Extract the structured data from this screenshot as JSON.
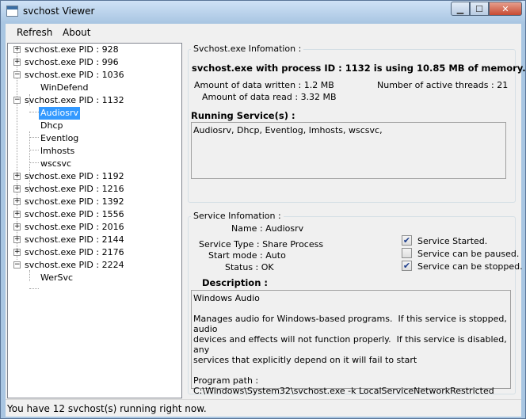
{
  "window": {
    "title": "svchost Viewer",
    "min": "▁",
    "max": "☐",
    "close": "✕"
  },
  "menu": {
    "refresh": "Refresh",
    "about": "About"
  },
  "tree": {
    "nodes": [
      {
        "label": "svchost.exe  PID : 928",
        "expander": "+"
      },
      {
        "label": "svchost.exe  PID : 996",
        "expander": "+"
      },
      {
        "label": "svchost.exe  PID : 1036",
        "expander": "−"
      },
      {
        "label": "WinDefend"
      },
      {
        "label": "svchost.exe  PID : 1132",
        "expander": "−"
      },
      {
        "label": "Audiosrv"
      },
      {
        "label": "Dhcp"
      },
      {
        "label": "Eventlog"
      },
      {
        "label": "lmhosts"
      },
      {
        "label": "wscsvc"
      },
      {
        "label": "svchost.exe  PID : 1192",
        "expander": "+"
      },
      {
        "label": "svchost.exe  PID : 1216",
        "expander": "+"
      },
      {
        "label": "svchost.exe  PID : 1392",
        "expander": "+"
      },
      {
        "label": "svchost.exe  PID : 1556",
        "expander": "+"
      },
      {
        "label": "svchost.exe  PID : 2016",
        "expander": "+"
      },
      {
        "label": "svchost.exe  PID : 2144",
        "expander": "+"
      },
      {
        "label": "svchost.exe  PID : 2176",
        "expander": "+"
      },
      {
        "label": "svchost.exe  PID : 2224",
        "expander": "−"
      },
      {
        "label": "WerSvc"
      }
    ]
  },
  "info": {
    "group_title": "Svchost.exe Infomation :",
    "headline": "svchost.exe with process ID : 1132 is using 10.85 MB of memory.",
    "data_written": "Amount of data written : 1.2 MB",
    "data_read": "Amount of data read : 3.32 MB",
    "threads": "Number of active threads : 21",
    "running_label": "Running Service(s) :",
    "running_value": "Audiosrv, Dhcp, Eventlog, lmhosts, wscsvc,"
  },
  "service": {
    "group_title": "Service Infomation :",
    "name": "Name : Audiosrv",
    "type": "Service Type : Share Process",
    "start_mode": "Start mode : Auto",
    "status": "Status : OK",
    "started_label": "Service Started.",
    "paused_label": "Service can be paused.",
    "stopped_label": "Service can be stopped.",
    "started_checked": "✔",
    "paused_checked": "",
    "stopped_checked": "✔",
    "description_label": "Description :",
    "description_text": "Windows Audio\n\nManages audio for Windows-based programs.  If this service is stopped, audio\ndevices and effects will not function properly.  If this service is disabled, any\nservices that explicitly depend on it will fail to start\n\nProgram path :\nC:\\Windows\\System32\\svchost.exe -k LocalServiceNetworkRestricted"
  },
  "status": {
    "text": "You have 12 svchost(s) running right now."
  }
}
